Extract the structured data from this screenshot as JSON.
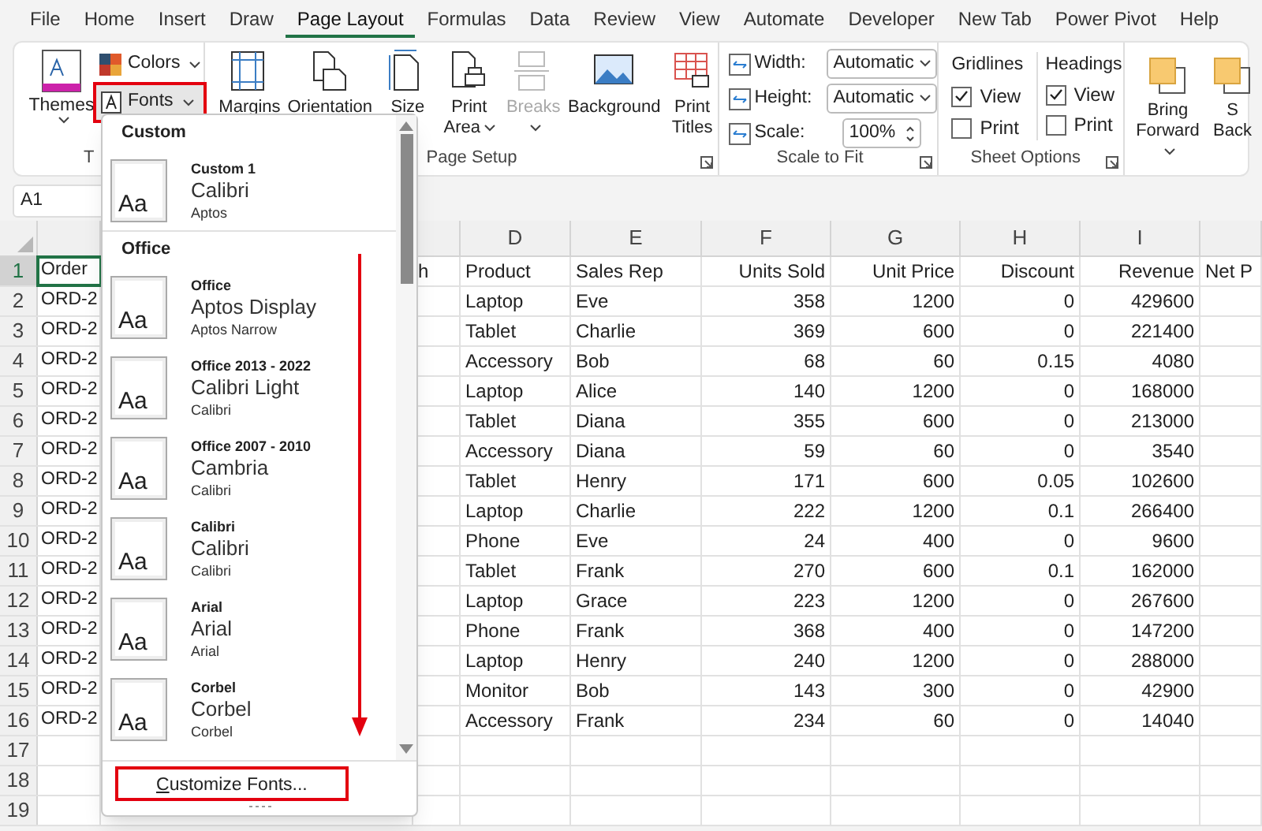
{
  "menu_tabs": [
    {
      "label": "File",
      "selected": false
    },
    {
      "label": "Home",
      "selected": false
    },
    {
      "label": "Insert",
      "selected": false
    },
    {
      "label": "Draw",
      "selected": false
    },
    {
      "label": "Page Layout",
      "selected": true
    },
    {
      "label": "Formulas",
      "selected": false
    },
    {
      "label": "Data",
      "selected": false
    },
    {
      "label": "Review",
      "selected": false
    },
    {
      "label": "View",
      "selected": false
    },
    {
      "label": "Automate",
      "selected": false
    },
    {
      "label": "Developer",
      "selected": false
    },
    {
      "label": "New Tab",
      "selected": false
    },
    {
      "label": "Power Pivot",
      "selected": false
    },
    {
      "label": "Help",
      "selected": false
    }
  ],
  "themes_group": {
    "label": "T",
    "themes": "Themes",
    "colors": "Colors",
    "fonts": "Fonts",
    "fonts_highlighted": true
  },
  "page_setup": {
    "label": "Page Setup",
    "buttons": [
      {
        "label": "Margins",
        "disabled": false,
        "dropdown": false
      },
      {
        "label": "Orientation",
        "disabled": false,
        "dropdown": false
      },
      {
        "label": "Size",
        "disabled": false,
        "dropdown": false
      },
      {
        "label": "Print Area",
        "disabled": false,
        "dropdown": true
      },
      {
        "label": "Breaks",
        "disabled": true,
        "dropdown": true
      },
      {
        "label": "Background",
        "disabled": false,
        "dropdown": false
      },
      {
        "label": "Print Titles",
        "disabled": false,
        "dropdown": false
      }
    ]
  },
  "scale_to_fit": {
    "label": "Scale to Fit",
    "rows": [
      {
        "kind": "select",
        "label": "Width:",
        "value": "Automatic"
      },
      {
        "kind": "select",
        "label": "Height:",
        "value": "Automatic"
      },
      {
        "kind": "spinner",
        "label": "Scale:",
        "value": "100%"
      }
    ]
  },
  "sheet_options": {
    "label": "Sheet Options",
    "columns": [
      {
        "title": "Gridlines",
        "options": [
          {
            "label": "View",
            "checked": true
          },
          {
            "label": "Print",
            "checked": false
          }
        ]
      },
      {
        "title": "Headings",
        "options": [
          {
            "label": "View",
            "checked": true
          },
          {
            "label": "Print",
            "checked": false
          }
        ]
      }
    ]
  },
  "arrange": {
    "buttons": [
      {
        "label": "Bring Forward",
        "dropdown": true
      },
      {
        "label": "S Back",
        "dropdown": false
      }
    ]
  },
  "name_box": "A1",
  "font_menu": {
    "sections": [
      {
        "title": "Custom",
        "items": [
          {
            "sample": "Aa",
            "name": "Custom 1",
            "heading": "Calibri",
            "body": "Aptos"
          }
        ]
      },
      {
        "title": "Office",
        "items": [
          {
            "sample": "Aa",
            "name": "Office",
            "heading": "Aptos Display",
            "body": "Aptos Narrow"
          },
          {
            "sample": "Aa",
            "name": "Office 2013 - 2022",
            "heading": "Calibri Light",
            "body": "Calibri"
          },
          {
            "sample": "Aa",
            "name": "Office 2007 - 2010",
            "heading": "Cambria",
            "body": "Calibri"
          },
          {
            "sample": "Aa",
            "name": "Calibri",
            "heading": "Calibri",
            "body": "Calibri"
          },
          {
            "sample": "Aa",
            "name": "Arial",
            "heading": "Arial",
            "body": "Arial"
          },
          {
            "sample": "Aa",
            "name": "Corbel",
            "heading": "Corbel",
            "body": "Corbel"
          }
        ]
      }
    ],
    "footer": "Customize Fonts...",
    "footer_highlighted": true
  },
  "sheet": {
    "column_headers": {
      "d": "D",
      "e": "E",
      "f": "F",
      "g": "G",
      "h": "H",
      "i": "I"
    },
    "rows": [
      {
        "number": "1",
        "selected": true,
        "cells": {
          "a": "Order",
          "c": "h",
          "d": "Product",
          "e": "Sales Rep",
          "f": "Units Sold",
          "g": "Unit Price",
          "h": "Discount",
          "i": "Revenue",
          "j": "Net P"
        }
      },
      {
        "number": "2",
        "selected": false,
        "cells": {
          "a": "ORD-2",
          "d": "Laptop",
          "e": "Eve",
          "f": "358",
          "g": "1200",
          "h": "0",
          "i": "429600"
        }
      },
      {
        "number": "3",
        "selected": false,
        "cells": {
          "a": "ORD-2",
          "d": "Tablet",
          "e": "Charlie",
          "f": "369",
          "g": "600",
          "h": "0",
          "i": "221400"
        }
      },
      {
        "number": "4",
        "selected": false,
        "cells": {
          "a": "ORD-2",
          "d": "Accessory",
          "e": "Bob",
          "f": "68",
          "g": "60",
          "h": "0.15",
          "i": "4080"
        }
      },
      {
        "number": "5",
        "selected": false,
        "cells": {
          "a": "ORD-2",
          "d": "Laptop",
          "e": "Alice",
          "f": "140",
          "g": "1200",
          "h": "0",
          "i": "168000"
        }
      },
      {
        "number": "6",
        "selected": false,
        "cells": {
          "a": "ORD-2",
          "d": "Tablet",
          "e": "Diana",
          "f": "355",
          "g": "600",
          "h": "0",
          "i": "213000"
        }
      },
      {
        "number": "7",
        "selected": false,
        "cells": {
          "a": "ORD-2",
          "d": "Accessory",
          "e": "Diana",
          "f": "59",
          "g": "60",
          "h": "0",
          "i": "3540"
        }
      },
      {
        "number": "8",
        "selected": false,
        "cells": {
          "a": "ORD-2",
          "d": "Tablet",
          "e": "Henry",
          "f": "171",
          "g": "600",
          "h": "0.05",
          "i": "102600"
        }
      },
      {
        "number": "9",
        "selected": false,
        "cells": {
          "a": "ORD-2",
          "d": "Laptop",
          "e": "Charlie",
          "f": "222",
          "g": "1200",
          "h": "0.1",
          "i": "266400"
        }
      },
      {
        "number": "10",
        "selected": false,
        "cells": {
          "a": "ORD-2",
          "d": "Phone",
          "e": "Eve",
          "f": "24",
          "g": "400",
          "h": "0",
          "i": "9600"
        }
      },
      {
        "number": "11",
        "selected": false,
        "cells": {
          "a": "ORD-2",
          "d": "Tablet",
          "e": "Frank",
          "f": "270",
          "g": "600",
          "h": "0.1",
          "i": "162000"
        }
      },
      {
        "number": "12",
        "selected": false,
        "cells": {
          "a": "ORD-2",
          "d": "Laptop",
          "e": "Grace",
          "f": "223",
          "g": "1200",
          "h": "0",
          "i": "267600"
        }
      },
      {
        "number": "13",
        "selected": false,
        "cells": {
          "a": "ORD-2",
          "d": "Phone",
          "e": "Frank",
          "f": "368",
          "g": "400",
          "h": "0",
          "i": "147200"
        }
      },
      {
        "number": "14",
        "selected": false,
        "cells": {
          "a": "ORD-2",
          "d": "Laptop",
          "e": "Henry",
          "f": "240",
          "g": "1200",
          "h": "0",
          "i": "288000"
        }
      },
      {
        "number": "15",
        "selected": false,
        "cells": {
          "a": "ORD-2",
          "d": "Monitor",
          "e": "Bob",
          "f": "143",
          "g": "300",
          "h": "0",
          "i": "42900"
        }
      },
      {
        "number": "16",
        "selected": false,
        "cells": {
          "a": "ORD-2",
          "d": "Accessory",
          "e": "Frank",
          "f": "234",
          "g": "60",
          "h": "0",
          "i": "14040"
        }
      },
      {
        "number": "17",
        "selected": false,
        "cells": {}
      },
      {
        "number": "18",
        "selected": false,
        "cells": {}
      },
      {
        "number": "19",
        "selected": false,
        "cells": {}
      }
    ]
  }
}
